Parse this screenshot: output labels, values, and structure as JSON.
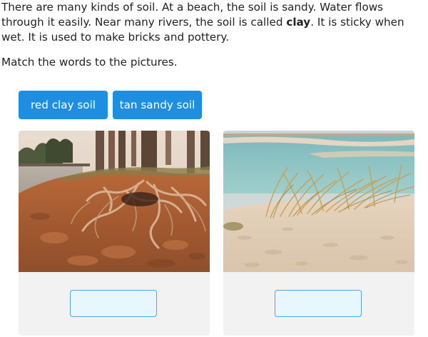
{
  "passage": {
    "part1": "There are many kinds of soil. At a beach, the soil is sandy. Water flows through it easily. Near many rivers, the soil is called ",
    "bold_word": "clay",
    "part2": ". It is sticky when wet. It is used to make bricks and pottery."
  },
  "instruction": "Match the words to the pictures.",
  "word_bank": [
    {
      "label": "red clay soil"
    },
    {
      "label": "tan sandy soil"
    }
  ],
  "cards": [
    {
      "image": "clay-soil-roots-photo",
      "answer_value": ""
    },
    {
      "image": "sandy-beach-dunes-photo",
      "answer_value": ""
    }
  ],
  "colors": {
    "button": "#1e8fe0",
    "dropzone_fill": "#e8f6fd",
    "dropzone_border": "#4aa8e6",
    "card_bg": "#f2f2f2"
  }
}
